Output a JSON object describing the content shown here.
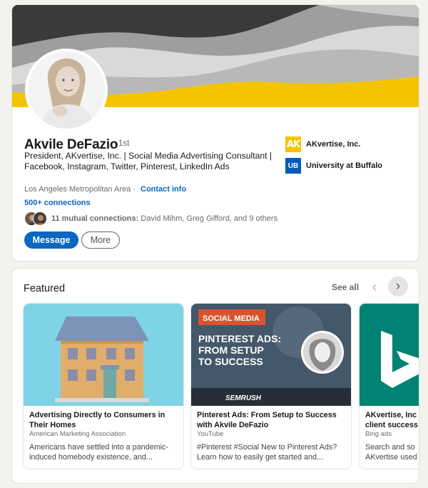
{
  "profile": {
    "name": "Akvile DeFazio",
    "degree": "· 1st",
    "headline": "President, AKvertise, Inc. | Social Media Advertising Consultant | Facebook, Instagram, Twitter, Pinterest, LinkedIn Ads",
    "location": "Los Angeles Metropolitan Area ·",
    "contact_info": "Contact info",
    "connections": "500+ connections",
    "mutual": {
      "count_label": "11 mutual connections:",
      "names": " David Mihm, Greg Gifford, and 9 others"
    },
    "buttons": {
      "message": "Message",
      "more": "More"
    },
    "organizations": [
      {
        "name": "AKvertise, Inc.",
        "logo_text": "AK",
        "logo_color": "#f5c400"
      },
      {
        "name": "University at Buffalo",
        "logo_text": "UB",
        "logo_color": "#005bbb"
      }
    ]
  },
  "featured": {
    "title": "Featured",
    "see_all": "See all",
    "prev_icon": "chevron-left-icon",
    "next_icon": "chevron-right-icon",
    "items": [
      {
        "title": "Advertising Directly to Consumers in Their Homes",
        "source": "American Marketing Association",
        "description": "Americans have settled into a pandemic-induced homebody existence, and..."
      },
      {
        "title": "Pinterest Ads: From Setup to Success with Akvile DeFazio",
        "source": "YouTube",
        "description": "#Pinterest #Social New to Pinterest Ads? Learn how to easily get started and...",
        "thumb_tag": "SOCIAL MEDIA",
        "thumb_headline": [
          "PINTEREST ADS:",
          "FROM SETUP",
          "TO SUCCESS"
        ],
        "thumb_brand": "SEMRUSH"
      },
      {
        "title": "AKvertise, Inc",
        "title_line2": "client success",
        "source": "Bing ads",
        "description": "Search and so",
        "description_line2": "AKvertise used"
      }
    ]
  },
  "colors": {
    "accent": "#0a66c2",
    "banner_yellow": "#f5c400",
    "bing_teal": "#008373"
  }
}
